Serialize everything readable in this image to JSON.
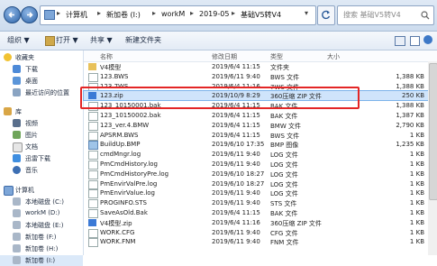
{
  "address": {
    "crumbs": [
      "计算机",
      "新加卷 (I:)",
      "workM",
      "2019-05",
      "基础V5转V4"
    ],
    "search_placeholder": "搜索 基础V5转V4"
  },
  "toolbar": {
    "organize": "组织 ▼",
    "open": "打开 ▼",
    "share": "共享 ▼",
    "new_folder": "新建文件夹"
  },
  "nav": {
    "favorites": "收藏夹",
    "fav_items": [
      "下载",
      "桌面",
      "最近访问的位置"
    ],
    "libraries": "库",
    "lib_items": [
      "视频",
      "图片",
      "文档",
      "迅雷下载",
      "音乐"
    ],
    "computer": "计算机",
    "drives": [
      "本地磁盘 (C:)",
      "workM (D:)",
      "本地磁盘 (E:)",
      "新加卷 (F:)",
      "新加卷 (H:)",
      "新加卷 (I:)"
    ]
  },
  "columns": {
    "name": "名称",
    "date": "修改日期",
    "type": "类型",
    "size": "大小"
  },
  "files": [
    {
      "name": "V4模型",
      "date": "2019/6/4 11:15",
      "type": "文件夹",
      "size": "",
      "icon": "folder"
    },
    {
      "name": "123.BWS",
      "date": "2019/6/11 9:40",
      "type": "BWS 文件",
      "size": "1,388 KB",
      "icon": "file"
    },
    {
      "name": "123.7WS",
      "date": "2019/6/4 11:16",
      "type": "7WS 文件",
      "size": "1,388 KB",
      "icon": "file"
    },
    {
      "name": "123.zip",
      "date": "2019/10/9 8:29",
      "type": "360压缩 ZIP 文件",
      "size": "250 KB",
      "icon": "zip"
    },
    {
      "name": "123_10150001.bak",
      "date": "2019/6/4 11:15",
      "type": "BAK 文件",
      "size": "1,388 KB",
      "icon": "file"
    },
    {
      "name": "123_10150002.bak",
      "date": "2019/6/4 11:15",
      "type": "BAK 文件",
      "size": "1,387 KB",
      "icon": "file"
    },
    {
      "name": "123_ver.4.BMW",
      "date": "2019/6/4 11:15",
      "type": "BMW 文件",
      "size": "2,790 KB",
      "icon": "file"
    },
    {
      "name": "APSRM.BWS",
      "date": "2019/6/4 11:15",
      "type": "BWS 文件",
      "size": "1 KB",
      "icon": "file"
    },
    {
      "name": "BuildUp.BMP",
      "date": "2019/6/10 17:35",
      "type": "BMP 图像",
      "size": "1,235 KB",
      "icon": "image"
    },
    {
      "name": "cmdMngr.log",
      "date": "2019/6/11 9:40",
      "type": "LOG 文件",
      "size": "1 KB",
      "icon": "file"
    },
    {
      "name": "PmCmdHistory.log",
      "date": "2019/6/11 9:40",
      "type": "LOG 文件",
      "size": "1 KB",
      "icon": "file"
    },
    {
      "name": "PmCmdHistoryPre.log",
      "date": "2019/6/10 18:27",
      "type": "LOG 文件",
      "size": "1 KB",
      "icon": "file"
    },
    {
      "name": "PmEnvirValPre.log",
      "date": "2019/6/10 18:27",
      "type": "LOG 文件",
      "size": "1 KB",
      "icon": "file"
    },
    {
      "name": "PmEnvirValue.log",
      "date": "2019/6/11 9:40",
      "type": "LOG 文件",
      "size": "1 KB",
      "icon": "file"
    },
    {
      "name": "PROGINFO.STS",
      "date": "2019/6/11 9:40",
      "type": "STS 文件",
      "size": "1 KB",
      "icon": "file"
    },
    {
      "name": "SaveAsOld.Bak",
      "date": "2019/6/4 11:15",
      "type": "BAK 文件",
      "size": "1 KB",
      "icon": "file"
    },
    {
      "name": "V4模型.zip",
      "date": "2019/6/4 11:16",
      "type": "360压缩 ZIP 文件",
      "size": "1 KB",
      "icon": "zip"
    },
    {
      "name": "WORK.CFG",
      "date": "2019/6/11 9:40",
      "type": "CFG 文件",
      "size": "1 KB",
      "icon": "file"
    },
    {
      "name": "WORK.FNM",
      "date": "2019/6/11 9:40",
      "type": "FNM 文件",
      "size": "1 KB",
      "icon": "file"
    }
  ],
  "colors": {
    "selection": "#cfe4fb",
    "highlight_box": "#e32626",
    "folder": "#e8c15a",
    "zip": "#3b7ad6"
  }
}
